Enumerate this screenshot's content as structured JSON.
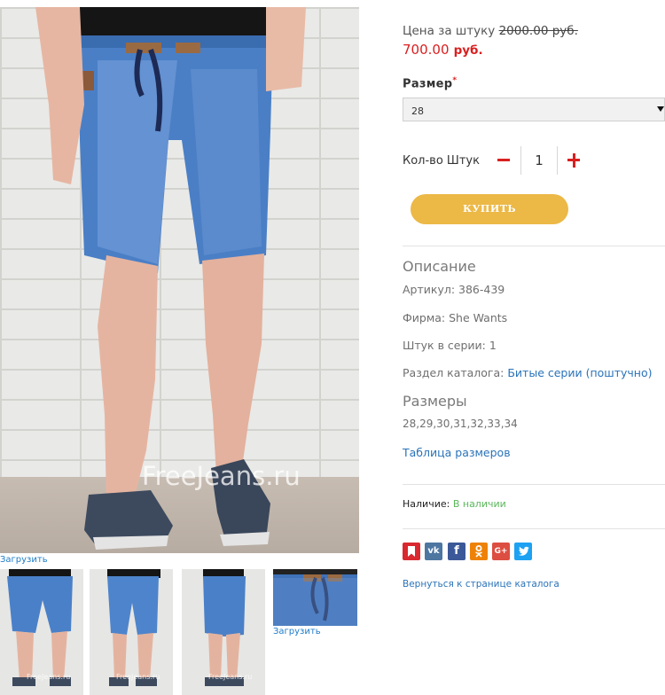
{
  "gallery": {
    "watermark": "FreeJeans.ru",
    "load_label": "Загрузить",
    "thumb_load_label": "Загрузить",
    "thumb_watermark": "FreeJeans.ru"
  },
  "price": {
    "label": "Цена за штуку",
    "old": "2000.00 руб.",
    "new_value": "700.00",
    "new_currency": "руб."
  },
  "size": {
    "label": "Размер",
    "required_mark": "*",
    "selected": "28"
  },
  "quantity": {
    "label": "Кол-во Штук",
    "value": "1"
  },
  "buy_label": "КУПИТЬ",
  "description": {
    "title": "Описание",
    "article": "Артикул: 386-439",
    "brand": "Фирма: She Wants",
    "pieces": "Штук в серии: 1",
    "catalog_label": "Раздел каталога:",
    "catalog_link": "Битые серии (поштучно)"
  },
  "sizes": {
    "title": "Размеры",
    "list": "28,29,30,31,32,33,34",
    "table_link": "Таблица размеров"
  },
  "availability": {
    "label": "Наличие:",
    "value": "В наличии"
  },
  "share": {
    "icons": [
      "bookmark-icon",
      "vk-icon",
      "facebook-icon",
      "odnoklassniki-icon",
      "google-plus-icon",
      "twitter-icon"
    ],
    "colors": [
      "#d9282f",
      "#4d76a1",
      "#3b5998",
      "#ee8208",
      "#dc4e41",
      "#1da1f2"
    ]
  },
  "back_link": "Вернуться к странице каталога"
}
